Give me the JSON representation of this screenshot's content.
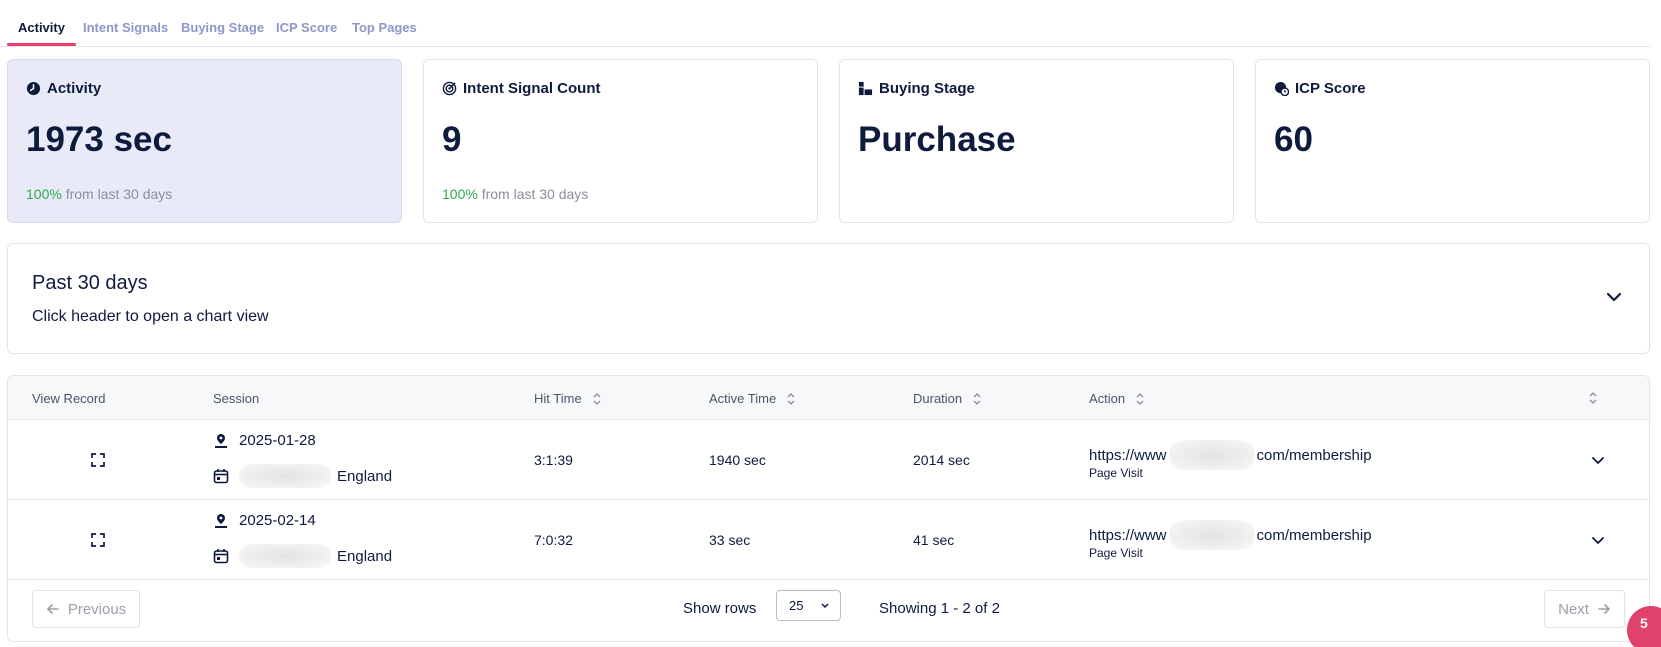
{
  "tabs": [
    {
      "label": "Activity",
      "active": true
    },
    {
      "label": "Intent Signals",
      "active": false
    },
    {
      "label": "Buying Stage",
      "active": false
    },
    {
      "label": "ICP Score",
      "active": false
    },
    {
      "label": "Top Pages",
      "active": false
    }
  ],
  "cards": [
    {
      "title": "Activity",
      "icon": "clock-icon",
      "value": "1973 sec",
      "change_pct": "100%",
      "change_text": "from last 30 days"
    },
    {
      "title": "Intent Signal Count",
      "icon": "target-icon",
      "value": "9",
      "change_pct": "100%",
      "change_text": "from last 30 days"
    },
    {
      "title": "Buying Stage",
      "icon": "stage-icon",
      "value": "Purchase"
    },
    {
      "title": "ICP Score",
      "icon": "score-icon",
      "value": "60"
    }
  ],
  "chart_panel": {
    "title": "Past 30 days",
    "subtitle": "Click header to open a chart view"
  },
  "table": {
    "headers": {
      "view_record": "View Record",
      "session": "Session",
      "hit_time": "Hit Time",
      "active_time": "Active Time",
      "duration": "Duration",
      "action": "Action"
    },
    "rows": [
      {
        "date": "2025-01-28",
        "location": "England",
        "hit_time": "3:1:39",
        "active_time": "1940 sec",
        "duration": "2014 sec",
        "url_prefix": "https://www",
        "url_suffix": "com/membership",
        "action_type": "Page Visit"
      },
      {
        "date": "2025-02-14",
        "location": "England",
        "hit_time": "7:0:32",
        "active_time": "33 sec",
        "duration": "41 sec",
        "url_prefix": "https://www",
        "url_suffix": "com/membership",
        "action_type": "Page Visit"
      }
    ]
  },
  "pagination": {
    "previous_label": "Previous",
    "next_label": "Next",
    "show_rows_label": "Show rows",
    "rows_per_page": "25",
    "showing_text": "Showing 1 - 2 of 2"
  },
  "chat_widget": {
    "badge": "5"
  },
  "colors": {
    "accent": "#e83e6c",
    "positive": "#2fa84f",
    "text": "#0f1b3d",
    "tab_inactive": "#8d97c8",
    "highlight_card": "#e8ebf7"
  }
}
